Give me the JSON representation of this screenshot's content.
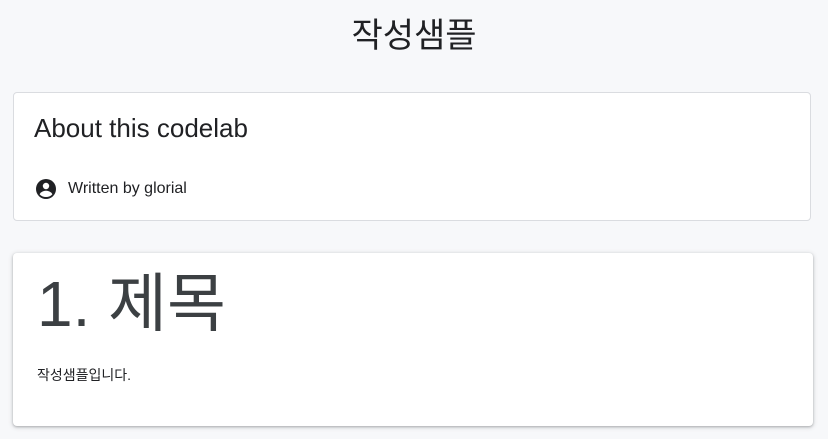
{
  "page": {
    "title": "작성샘플"
  },
  "about": {
    "heading": "About this codelab",
    "author_icon": "account-circle-icon",
    "author_text": "Written by glorial"
  },
  "step": {
    "heading": "1. 제목",
    "body": "작성샘플입니다."
  }
}
